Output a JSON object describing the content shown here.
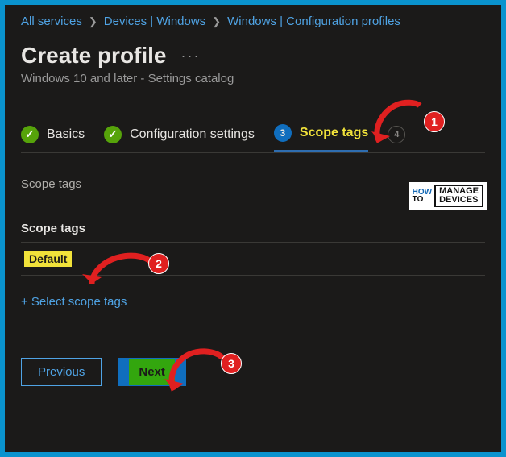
{
  "breadcrumb": {
    "item1": "All services",
    "item2": "Devices | Windows",
    "item3": "Windows | Configuration profiles"
  },
  "header": {
    "title": "Create profile",
    "more": "···",
    "subtitle": "Windows 10 and later - Settings catalog"
  },
  "wizard": {
    "step1": "Basics",
    "step2": "Configuration settings",
    "step3_num": "3",
    "step3": "Scope tags",
    "step4_num": "4"
  },
  "section": {
    "label": "Scope tags",
    "col_header": "Scope tags"
  },
  "rows": {
    "r0": "Default"
  },
  "add_link": "+ Select scope tags",
  "buttons": {
    "previous": "Previous",
    "next": "Next"
  },
  "annotations": {
    "n1": "1",
    "n2": "2",
    "n3": "3"
  },
  "watermark": {
    "how": "HOW",
    "to": "TO",
    "l1": "MANAGE",
    "l2": "DEVICES"
  }
}
